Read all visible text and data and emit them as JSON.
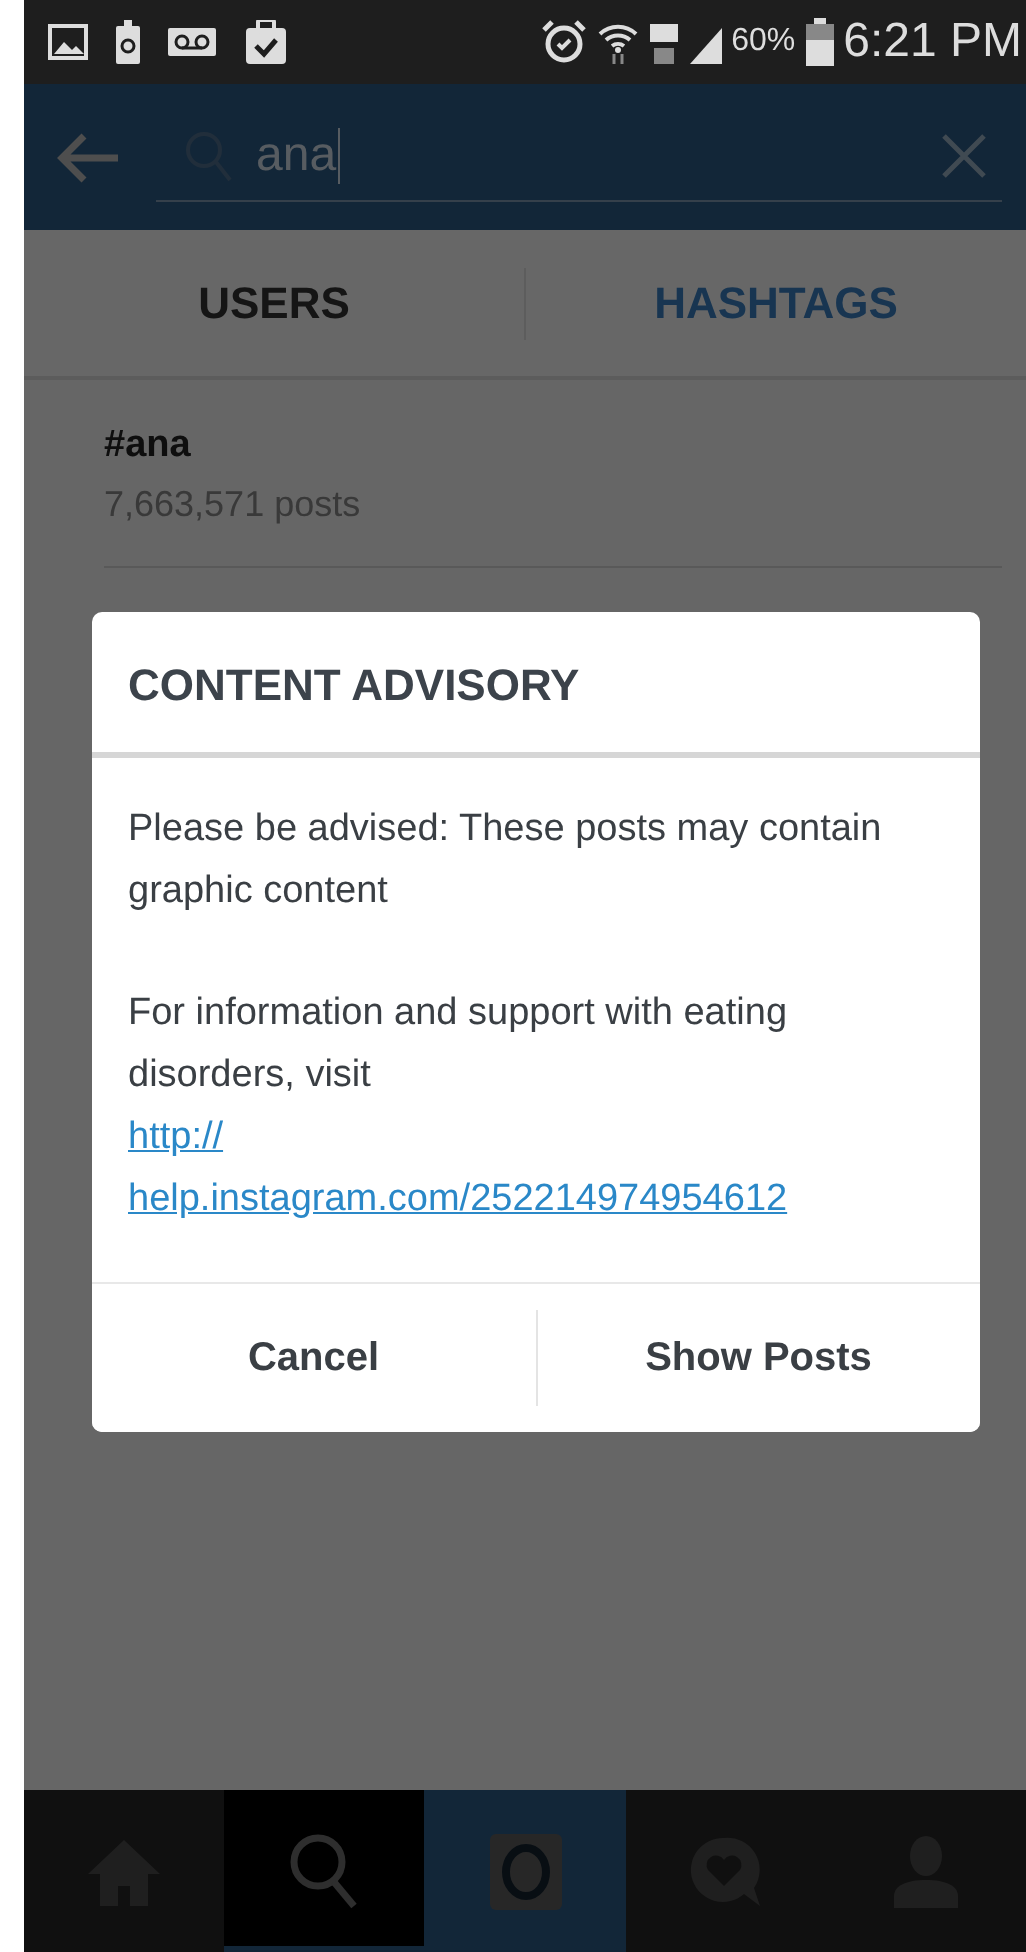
{
  "status_bar": {
    "battery": "60%",
    "time": "6:21 PM"
  },
  "search": {
    "value": "ana"
  },
  "tabs": [
    {
      "label": "USERS",
      "selected": false
    },
    {
      "label": "HASHTAGS",
      "selected": true
    }
  ],
  "results": [
    {
      "tag": "#ana",
      "count": "7,663,571 posts"
    }
  ],
  "dialog": {
    "title": "CONTENT ADVISORY",
    "paragraphs": [
      "Please be advised: These posts may contain graphic content",
      "For information and support with eating disorders, visit"
    ],
    "link_lines": [
      "http://",
      "help.instagram.com/252214974954612"
    ],
    "buttons": [
      "Cancel",
      "Show Posts"
    ]
  },
  "bottom_nav": [
    {
      "kind": "home",
      "selected": false
    },
    {
      "kind": "search",
      "selected": true
    },
    {
      "kind": "camera",
      "selected": false
    },
    {
      "kind": "activity",
      "selected": false
    },
    {
      "kind": "profile",
      "selected": false
    }
  ]
}
